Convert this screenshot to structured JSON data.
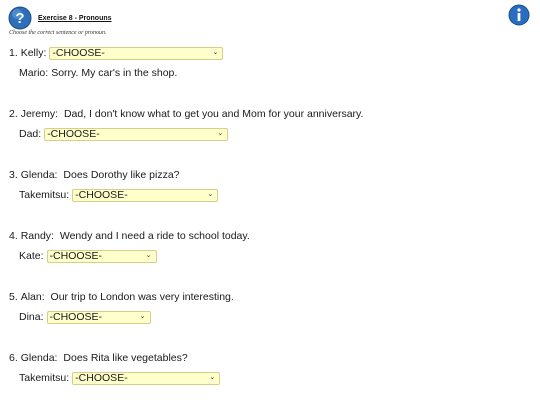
{
  "header": {
    "title": "Exercise 8 - Pronouns",
    "instructions": "Choose the correct sentence or pronoun."
  },
  "colors": {
    "help_icon": "#2d6fb8",
    "info_icon": "#2a6cc0",
    "select_background": "#ffffcc"
  },
  "exercises": [
    {
      "number": "1.",
      "speaker_a": "Kelly:",
      "line_a": "",
      "select_a": "-CHOOSE-",
      "speaker_b": "Mario:",
      "line_b": "Sorry. My car's in the shop."
    },
    {
      "number": "2.",
      "speaker_a": "Jeremy:",
      "line_a": "Dad, I don't know what to get you and Mom for your anniversary.",
      "speaker_b": "Dad:",
      "select_b": "-CHOOSE-"
    },
    {
      "number": "3.",
      "speaker_a": "Glenda:",
      "line_a": "Does Dorothy like pizza?",
      "speaker_b": "Takemitsu:",
      "select_b": "-CHOOSE-"
    },
    {
      "number": "4.",
      "speaker_a": "Randy:",
      "line_a": "Wendy and I need a ride to school today.",
      "speaker_b": "Kate:",
      "select_b": "-CHOOSE-"
    },
    {
      "number": "5.",
      "speaker_a": "Alan:",
      "line_a": "Our trip to London was very interesting.",
      "speaker_b": "Dina:",
      "select_b": "-CHOOSE-"
    },
    {
      "number": "6.",
      "speaker_a": "Glenda:",
      "line_a": "Does Rita like vegetables?",
      "speaker_b": "Takemitsu:",
      "select_b": "-CHOOSE-"
    }
  ]
}
